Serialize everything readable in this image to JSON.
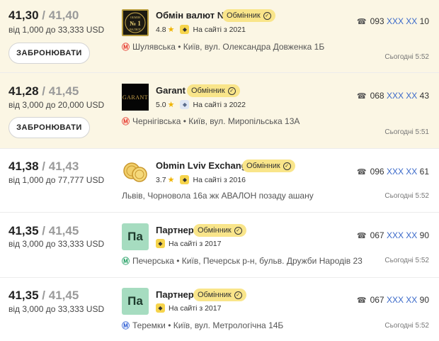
{
  "listings": [
    {
      "buy": "41,30",
      "sell": "41,40",
      "separator": "/",
      "range": "від 1,000 до 33,333 USD",
      "book_label": "ЗАБРОНЮВАТИ",
      "logo_text": "ОБМІН № 1 ВАЛЮТ",
      "name": "Обмін валют №1",
      "badge": "Обмінник",
      "rating": "4.8",
      "since": "На сайті з 2021",
      "metro_icon": "metro-icon",
      "metro_color": "#e8463a",
      "address": "Шулявська • Київ, вул. Олександра Довженка 1Б",
      "phone_prefix": "093",
      "phone_mask": "XXX XX",
      "phone_suffix": "10",
      "time": "Сьогодні 5:52"
    },
    {
      "buy": "41,28",
      "sell": "41,45",
      "separator": "/",
      "range": "від 3,000 до 20,000 USD",
      "book_label": "ЗАБРОНЮВАТИ",
      "logo_text": "GARANT",
      "name": "Garant",
      "badge": "Обмінник",
      "rating": "5.0",
      "since": "На сайті з 2022",
      "metro_icon": "metro-icon",
      "metro_color": "#e8463a",
      "address": "Чернігівська • Київ, вул. Миропільська 13А",
      "phone_prefix": "068",
      "phone_mask": "XXX XX",
      "phone_suffix": "43",
      "time": "Сьогодні 5:51"
    },
    {
      "buy": "41,38",
      "sell": "41,43",
      "separator": "/",
      "range": "від 1,000 до 77,777 USD",
      "name": "Obmin Lviv Exchange",
      "badge": "Обмінник",
      "rating": "3.7",
      "since": "На сайті з 2016",
      "address": "Львів, Чорновола 16а жк АВАЛОН позаду ашану",
      "phone_prefix": "096",
      "phone_mask": "XXX XX",
      "phone_suffix": "61",
      "time": "Сьогодні 5:52"
    },
    {
      "buy": "41,35",
      "sell": "41,45",
      "separator": "/",
      "range": "від 3,000 до 33,333 USD",
      "logo_text": "Па",
      "name": "Партнер",
      "badge": "Обмінник",
      "since": "На сайті з 2017",
      "metro_icon": "metro-icon",
      "metro_color": "#2ea46b",
      "address": "Печерська • Київ, Печерськ р-н, бульв. Дружби Народів 23",
      "phone_prefix": "067",
      "phone_mask": "XXX XX",
      "phone_suffix": "90",
      "time": "Сьогодні 5:52"
    },
    {
      "buy": "41,35",
      "sell": "41,45",
      "separator": "/",
      "range": "від 3,000 до 33,333 USD",
      "logo_text": "Па",
      "name": "Партнер",
      "badge": "Обмінник",
      "since": "На сайті з 2017",
      "metro_icon": "metro-icon",
      "metro_color": "#3a67d6",
      "address": "Теремки • Київ, вул. Метрологічна 14Б",
      "phone_prefix": "067",
      "phone_mask": "XXX XX",
      "phone_suffix": "90",
      "time": "Сьогодні 5:52"
    }
  ],
  "icons": {
    "star": "star-icon",
    "diamond": "diamond-icon",
    "verified": "verified-check-icon",
    "phone": "phone-icon",
    "metro": "metro-icon"
  },
  "colors": {
    "highlight_bg": "#fbf6e4",
    "badge_bg": "#f9e58a",
    "phone_mask": "#3968c9",
    "star": "#f0b400"
  }
}
